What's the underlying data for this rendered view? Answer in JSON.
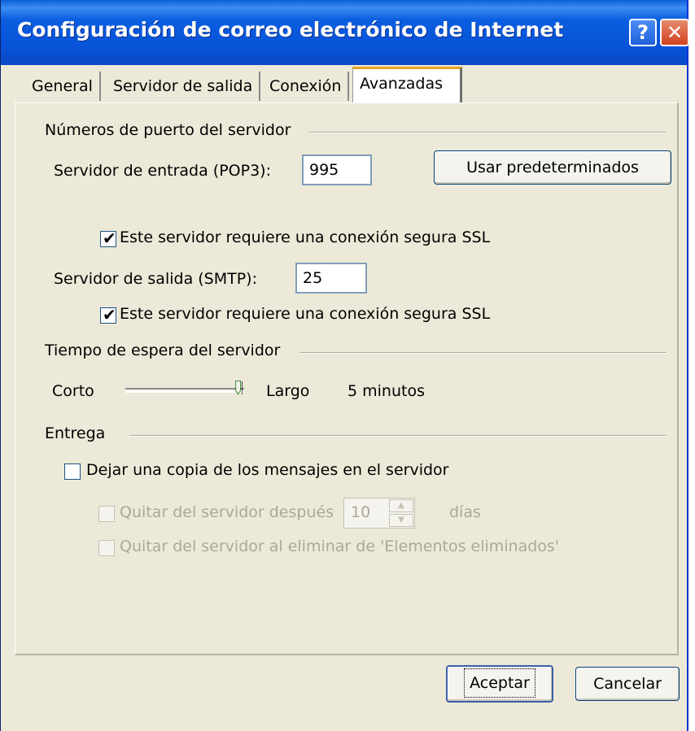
{
  "window": {
    "title": "Configuración de correo electrónico de Internet",
    "help_glyph": "?",
    "close_glyph": "✕"
  },
  "tabs": [
    {
      "label": "General"
    },
    {
      "label": "Servidor de salida"
    },
    {
      "label": "Conexión"
    },
    {
      "label": "Avanzadas",
      "active": true
    }
  ],
  "ports": {
    "group_label": "Números de puerto del servidor",
    "incoming_label": "Servidor de entrada (POP3):",
    "incoming_value": "995",
    "incoming_ssl_label": "Este servidor requiere una conexión segura SSL",
    "incoming_ssl_checked": true,
    "outgoing_label": "Servidor de salida (SMTP):",
    "outgoing_value": "25",
    "outgoing_ssl_label": "Este servidor requiere una conexión segura SSL",
    "outgoing_ssl_checked": true,
    "defaults_button": "Usar predeterminados"
  },
  "timeout": {
    "group_label": "Tiempo de espera del servidor",
    "short_label": "Corto",
    "long_label": "Largo",
    "value_text": "5 minutos",
    "slider_fraction": 1.0
  },
  "delivery": {
    "group_label": "Entrega",
    "leave_copy_label": "Dejar una copia de los mensajes en el servidor",
    "leave_copy_checked": false,
    "remove_after_label": "Quitar del servidor después",
    "remove_after_value": "10",
    "remove_after_unit": "días",
    "remove_deleted_label": "Quitar del servidor al eliminar de 'Elementos eliminados'"
  },
  "buttons": {
    "ok": "Aceptar",
    "cancel": "Cancelar"
  }
}
